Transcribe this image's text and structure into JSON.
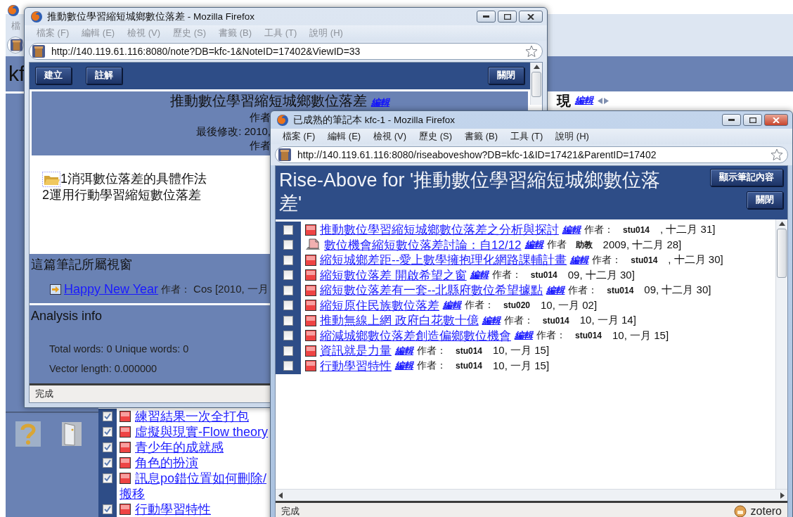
{
  "background_window": {
    "menu_item": "檔",
    "site_title": "kf",
    "page_heading": "現",
    "edit_link": "編輯",
    "list": [
      {
        "title": "練習結果一次全打包",
        "checked": true
      },
      {
        "title": "虛擬與現實-Flow theory",
        "checked": true
      },
      {
        "title": "青少年的成就感",
        "checked": true
      },
      {
        "title": "角色的扮演",
        "checked": true
      },
      {
        "title": "訊息po錯位置如何刪除/搬移",
        "checked": true
      },
      {
        "title": "行動學習特性",
        "checked": true
      }
    ]
  },
  "note_window": {
    "title": "推動數位學習縮短城鄉數位落差 - Mozilla Firefox",
    "active": false,
    "menu": [
      "檔案 (F)",
      "編輯 (E)",
      "檢視 (V)",
      "歷史 (S)",
      "書籤 (B)",
      "工具 (T)",
      "說明 (H)"
    ],
    "url": "http://140.119.61.116:8080/note?DB=kfc-1&NoteID=17402&ViewID=33",
    "toolbar_buttons": [
      "建立",
      "註解"
    ],
    "close_button": "關閉",
    "note_title": "推動數位學習縮短城鄉數位落差",
    "edit_link": "編輯",
    "meta_lines": [
      "作者",
      "最後修改: 2010,",
      "作者"
    ],
    "body_lines": [
      "1消弭數位落差的具體作法",
      "2運用行動學習縮短數位落差"
    ],
    "views_heading": "這篇筆記所屬視窗",
    "view": {
      "link": "Happy New Year",
      "author_label": "作者：",
      "author_info": "Cos [2010, 一月"
    },
    "analysis_heading": "Analysis info",
    "analysis_lines": [
      "Total words: 0 Unique words: 0",
      "Vector length: 0.000000"
    ],
    "status": "完成"
  },
  "riseabove_window": {
    "title": "已成熟的筆記本 kfc-1 - Mozilla Firefox",
    "active": true,
    "menu": [
      "檔案 (F)",
      "編輯 (E)",
      "檢視 (V)",
      "歷史 (S)",
      "書籤 (B)",
      "工具 (T)",
      "說明 (H)"
    ],
    "url": "http://140.119.61.116:8080/riseaboveshow?DB=kfc-1&ID=17421&ParentID=17402",
    "heading": "Rise-Above for '推動數位學習縮短城鄉數位落差'",
    "buttons": [
      "顯示筆記內容",
      "關閉"
    ],
    "items": [
      {
        "kind": "note",
        "title": "推動數位學習縮短城鄉數位落差之分析與探討",
        "edit_link": "編輯",
        "author_label": "作者：",
        "author": "stu014",
        "date": ", 十二月 31]",
        "checked": false
      },
      {
        "kind": "document",
        "title": "數位機會縮短數位落差討論：自12/12",
        "edit_link": "編輯",
        "author_label": "作者",
        "author": "助教",
        "date": "2009, 十二月 28]",
        "checked": false
      },
      {
        "kind": "note",
        "title": "縮短城鄉差距--愛上數學擁抱理化網路課輔計畫",
        "edit_link": "編輯",
        "author_label": "作者：",
        "author": "stu014",
        "date": ", 十二月 30]",
        "checked": false
      },
      {
        "kind": "note",
        "title": "縮短數位落差 開啟希望之窗",
        "edit_link": "編輯",
        "author_label": "作者：",
        "author": "stu014",
        "date": "09, 十二月 30]",
        "checked": false
      },
      {
        "kind": "note",
        "title": "縮短數位落差有一套--北縣府數位希望據點",
        "edit_link": "編輯",
        "author_label": "作者：",
        "author": "stu014",
        "date": "09, 十二月 30]",
        "checked": false
      },
      {
        "kind": "note",
        "title": "縮短原住民族數位落差",
        "edit_link": "編輯",
        "author_label": "作者：",
        "author": "stu020",
        "date": "10, 一月 02]",
        "checked": false
      },
      {
        "kind": "note",
        "title": "推動無線上網 政府白花數十億",
        "edit_link": "編輯",
        "author_label": "作者：",
        "author": "stu014",
        "date": "10, 一月 14]",
        "checked": false
      },
      {
        "kind": "note",
        "title": "縮減城鄉數位落差創造偏鄉數位機會",
        "edit_link": "編輯",
        "author_label": "作者：",
        "author": "stu014",
        "date": "10, 一月 15]",
        "checked": false
      },
      {
        "kind": "note",
        "title": "資訊就是力量",
        "edit_link": "編輯",
        "author_label": "作者：",
        "author": "stu014",
        "date": "10, 一月 15]",
        "checked": false
      },
      {
        "kind": "note",
        "title": "行動學習特性",
        "edit_link": "編輯",
        "author_label": "作者：",
        "author": "stu014",
        "date": "10, 一月 15]",
        "checked": false
      }
    ],
    "status": "完成",
    "addon": "zotero"
  }
}
